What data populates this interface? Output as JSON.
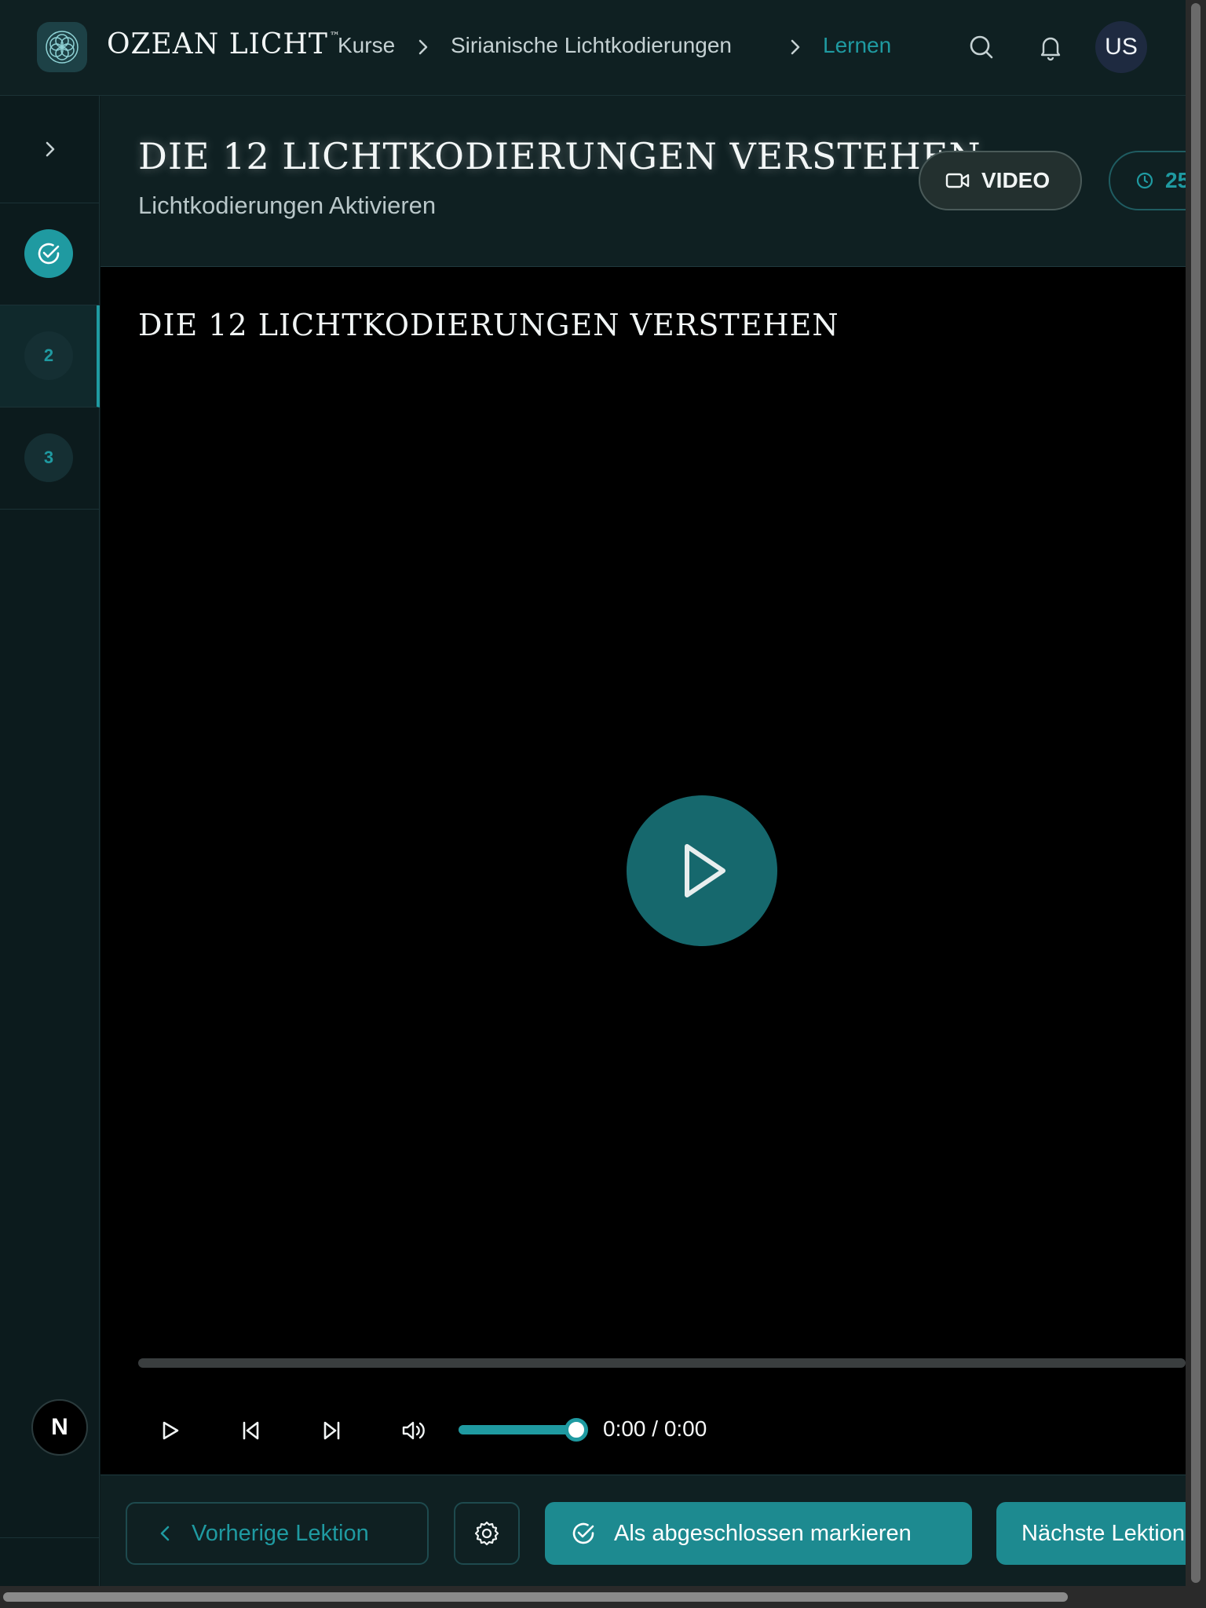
{
  "header": {
    "brand": "OZEAN LICHT",
    "brand_tm": "™",
    "breadcrumbs": [
      "Kurse",
      "Sirianische Lichtkodierungen",
      "Lernen"
    ],
    "avatar_initials": "US"
  },
  "sidebar": {
    "items": [
      {
        "label": "",
        "state": "completed"
      },
      {
        "label": "2",
        "state": "active"
      },
      {
        "label": "3",
        "state": "pending"
      }
    ],
    "bottom_badge": "N"
  },
  "lesson": {
    "title": "DIE 12 LICHTKODIERUNGEN VERSTEHEN",
    "subtitle": "Lichtkodierungen Aktivieren",
    "type_label": "VIDEO",
    "duration_label": "25"
  },
  "player": {
    "title": "DIE 12 LICHTKODIERUNGEN VERSTEHEN",
    "time": "0:00 / 0:00",
    "progress": 0,
    "volume": 1.0
  },
  "footer": {
    "prev_label": "Vorherige Lektion",
    "complete_label": "Als abgeschlossen markieren",
    "next_label": "Nächste Lektion"
  },
  "colors": {
    "accent": "#1f9aa1",
    "background": "#0c1b1d",
    "panel": "#0f2022",
    "button_fill": "#1d8a90"
  }
}
